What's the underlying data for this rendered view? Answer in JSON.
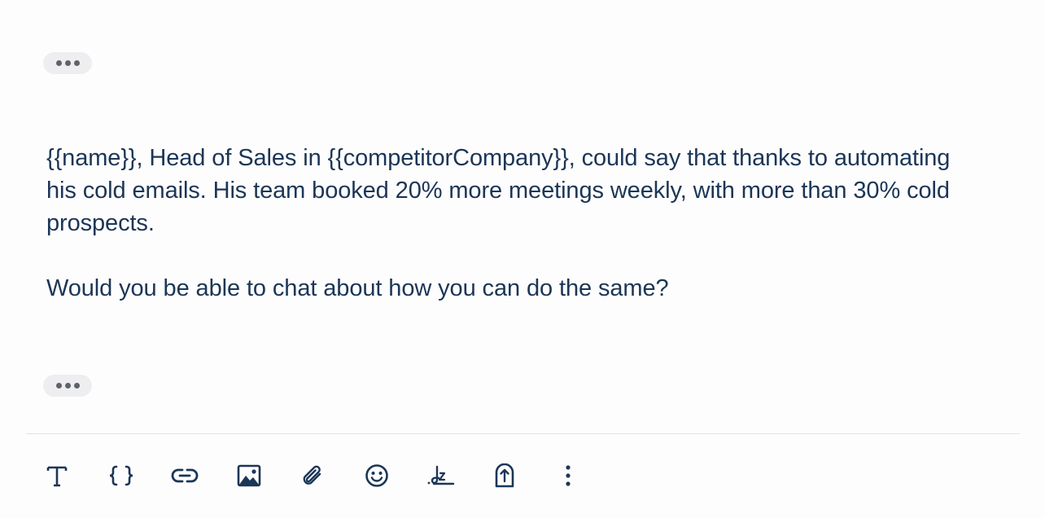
{
  "quoted_toggle_top": {
    "icon": "ellipsis-icon"
  },
  "message": {
    "paragraph_1": "{{name}}, Head of Sales in {{competitorCompany}}, could say that thanks to automating his cold emails. His team booked 20% more meetings weekly, with more than 30% cold prospects.",
    "paragraph_2": "Would you be able to chat about how you can do the same?"
  },
  "quoted_toggle_bottom": {
    "icon": "ellipsis-icon"
  },
  "toolbar": {
    "items": [
      {
        "icon": "text-format-icon"
      },
      {
        "icon": "variables-braces-icon"
      },
      {
        "icon": "link-icon"
      },
      {
        "icon": "image-icon"
      },
      {
        "icon": "attachment-icon"
      },
      {
        "icon": "emoji-icon"
      },
      {
        "icon": "signature-icon"
      },
      {
        "icon": "template-icon"
      },
      {
        "icon": "more-options-icon"
      }
    ]
  },
  "colors": {
    "text": "#1b3656",
    "pill_background": "#eeedf0",
    "divider": "#e1e2e5",
    "icon": "#1b3656"
  }
}
